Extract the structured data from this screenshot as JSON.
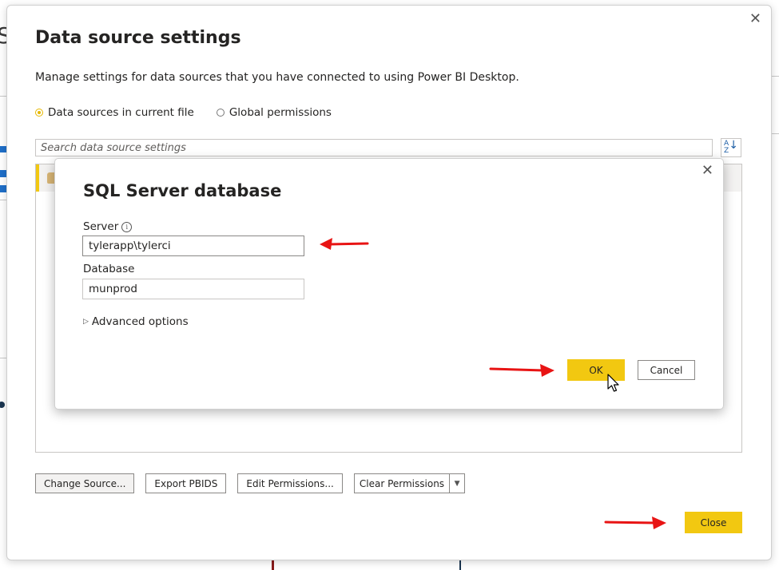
{
  "dialog": {
    "title": "Data source settings",
    "description": "Manage settings for data sources that you have connected to using Power BI Desktop.",
    "close_glyph": "✕",
    "scope": {
      "options": [
        "Data sources in current file",
        "Global permissions"
      ],
      "selected": "Data sources in current file"
    },
    "search_placeholder": "Search data source settings",
    "sort_icon": "sort-az-icon",
    "buttons": {
      "change_source": "Change Source...",
      "export_pbids": "Export PBIDS",
      "edit_permissions": "Edit Permissions...",
      "clear_permissions": "Clear Permissions",
      "close": "Close"
    }
  },
  "sql_dialog": {
    "title": "SQL Server database",
    "close_glyph": "✕",
    "server_label": "Server",
    "server_value": "tylerapp\\tylerci",
    "database_label": "Database",
    "database_value": "munprod",
    "advanced_options": "Advanced options",
    "ok_label": "OK",
    "cancel_label": "Cancel"
  },
  "colors": {
    "accent_yellow": "#f2c811",
    "annotation_red": "#e81414",
    "border": "#8a8886"
  }
}
